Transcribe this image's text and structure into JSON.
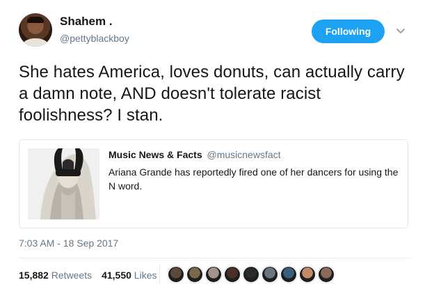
{
  "user": {
    "display_name": "Shahem .",
    "handle": "@pettyblackboy",
    "follow_label": "Following"
  },
  "tweet": {
    "text": "She hates America, loves donuts, can actually carry a damn note, AND doesn't tolerate racist foolishness? I stan.",
    "timestamp": "7:03 AM - 18 Sep 2017"
  },
  "quote": {
    "name": "Music News & Facts",
    "handle": "@musicnewsfact",
    "text": "Ariana Grande has reportedly fired one of her dancers for using the N word."
  },
  "stats": {
    "retweets_count": "15,882",
    "retweets_label": "Retweets",
    "likes_count": "41,550",
    "likes_label": "Likes"
  },
  "colors": {
    "accent": "#1da1f2",
    "secondary_text": "#657786",
    "primary_text": "#14171a"
  },
  "icons": {
    "more": "chevron-down-icon"
  },
  "likers": [
    {
      "color": "#5b4a3a"
    },
    {
      "color": "#7a6a4a"
    },
    {
      "color": "#a4938a"
    },
    {
      "color": "#4a3028"
    },
    {
      "color": "#2a2a2a"
    },
    {
      "color": "#6a7580"
    },
    {
      "color": "#3b5f7a"
    },
    {
      "color": "#c38a6a"
    },
    {
      "color": "#8a6a5a"
    }
  ]
}
